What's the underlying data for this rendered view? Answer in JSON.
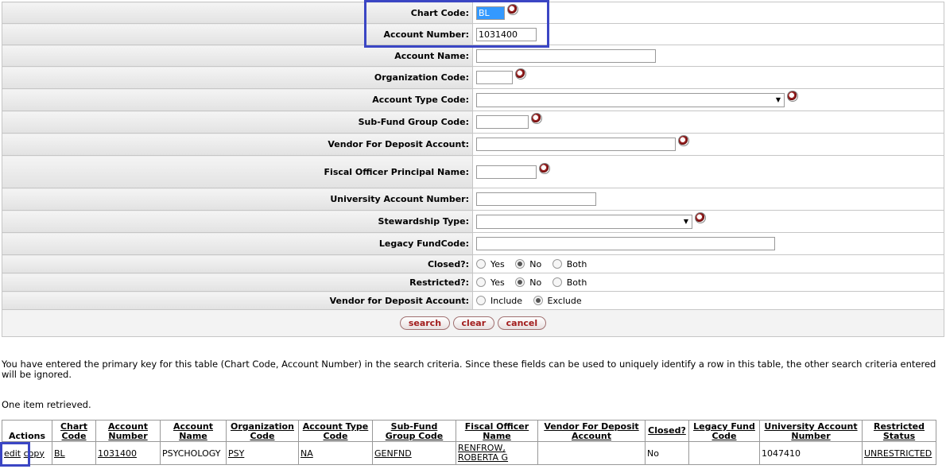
{
  "form": {
    "chart_code": {
      "label": "Chart Code:",
      "value": "BL"
    },
    "account_number": {
      "label": "Account Number:",
      "value": "1031400"
    },
    "account_name": {
      "label": "Account Name:",
      "value": ""
    },
    "organization_code": {
      "label": "Organization Code:",
      "value": ""
    },
    "account_type_code": {
      "label": "Account Type Code:",
      "value": ""
    },
    "sub_fund_group_code": {
      "label": "Sub-Fund Group Code:",
      "value": ""
    },
    "vendor_for_deposit_account": {
      "label": "Vendor For Deposit Account:",
      "value": ""
    },
    "fiscal_officer_principal_name": {
      "label": "Fiscal Officer Principal Name:",
      "value": ""
    },
    "university_account_number": {
      "label": "University Account Number:",
      "value": ""
    },
    "stewardship_type": {
      "label": "Stewardship Type:",
      "value": ""
    },
    "legacy_fund_code": {
      "label": "Legacy FundCode:",
      "value": ""
    },
    "closed": {
      "label": "Closed?:",
      "options": [
        "Yes",
        "No",
        "Both"
      ],
      "selected": "No"
    },
    "restricted": {
      "label": "Restricted?:",
      "options": [
        "Yes",
        "No",
        "Both"
      ],
      "selected": "No"
    },
    "vendor_deposit_filter": {
      "label": "Vendor for Deposit Account:",
      "options": [
        "Include",
        "Exclude"
      ],
      "selected": "Exclude"
    }
  },
  "buttons": {
    "search": "search",
    "clear": "clear",
    "cancel": "cancel"
  },
  "message": "You have entered the primary key for this table (Chart Code, Account Number) in the search criteria. Since these fields can be used to uniquely identify a row in this table, the other search criteria entered will be ignored.",
  "result_count": "One item retrieved.",
  "results": {
    "columns": [
      {
        "l1": "Actions",
        "l2": ""
      },
      {
        "l1": "Chart",
        "l2": "Code"
      },
      {
        "l1": "Account",
        "l2": "Number"
      },
      {
        "l1": "Account",
        "l2": "Name"
      },
      {
        "l1": "Organization",
        "l2": "Code"
      },
      {
        "l1": "Account Type",
        "l2": "Code"
      },
      {
        "l1": "Sub-Fund",
        "l2": "Group Code"
      },
      {
        "l1": "Fiscal Officer",
        "l2": "Name"
      },
      {
        "l1": "Vendor For Deposit",
        "l2": "Account"
      },
      {
        "l1": "Closed?",
        "l2": ""
      },
      {
        "l1": "Legacy Fund",
        "l2": "Code"
      },
      {
        "l1": "University Account",
        "l2": "Number"
      },
      {
        "l1": "Restricted",
        "l2": "Status"
      }
    ],
    "row": {
      "edit": "edit",
      "copy": "copy",
      "chart_code": "BL",
      "account_number": "1031400",
      "account_name": "PSYCHOLOGY",
      "organization_code": "PSY",
      "account_type_code": "NA",
      "sub_fund_group_code": "GENFND",
      "fiscal_officer_line1": "RENFROW,",
      "fiscal_officer_line2": "ROBERTA G",
      "vendor_for_deposit": "",
      "closed": "No",
      "legacy_fund_code": "",
      "university_account_number": "1047410",
      "restricted_status": "UNRESTRICTED"
    }
  },
  "colors": {
    "highlight": "#3b46c4",
    "button_text": "#a21c1c"
  }
}
